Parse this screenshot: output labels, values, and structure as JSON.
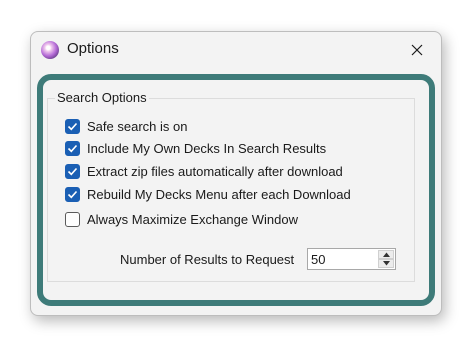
{
  "window": {
    "title": "Options",
    "icon": "app-orb-icon",
    "close_icon": "close-icon"
  },
  "search_options": {
    "group_title": "Search Options",
    "checkboxes": [
      {
        "label": "Safe search is on",
        "checked": true
      },
      {
        "label": "Include My Own Decks In Search Results",
        "checked": true
      },
      {
        "label": "Extract zip files automatically after download",
        "checked": true
      },
      {
        "label": "Rebuild My Decks Menu after each Download",
        "checked": true
      },
      {
        "label": "Always Maximize Exchange Window",
        "checked": false
      }
    ],
    "results_label": "Number of Results to Request",
    "results_value": "50"
  },
  "colors": {
    "highlight_border": "#3e7b79",
    "checkbox_checked": "#1a5fb4",
    "window_bg": "#f3f3f3"
  }
}
